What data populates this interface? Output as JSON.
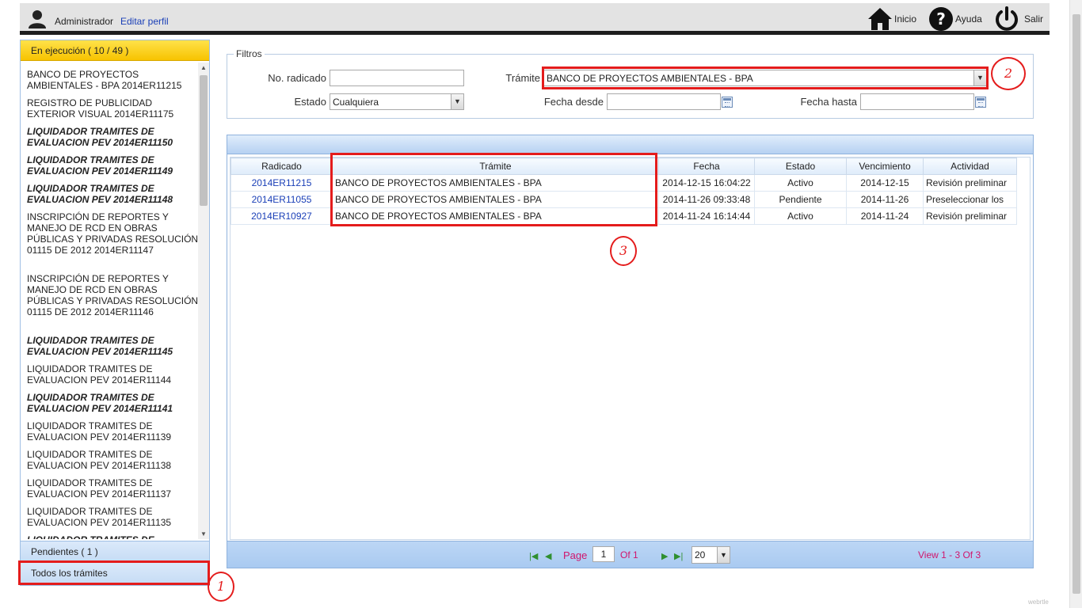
{
  "header": {
    "user_name": "Administrador",
    "edit_profile": "Editar perfil",
    "inicio": "Inicio",
    "ayuda": "Ayuda",
    "salir": "Salir"
  },
  "sidebar": {
    "ejecucion_label": "En ejecución ( 10 / 49 )",
    "pendientes_label": "Pendientes ( 1 )",
    "todos_label": "Todos los trámites",
    "items": [
      {
        "text": "BANCO DE PROYECTOS AMBIENTALES - BPA 2014ER11215",
        "bold": false
      },
      {
        "text": "REGISTRO DE PUBLICIDAD EXTERIOR VISUAL 2014ER11175",
        "bold": false
      },
      {
        "text": "LIQUIDADOR TRAMITES DE EVALUACION PEV 2014ER11150",
        "bold": true
      },
      {
        "text": "LIQUIDADOR TRAMITES DE EVALUACION PEV 2014ER11149",
        "bold": true
      },
      {
        "text": "LIQUIDADOR TRAMITES DE EVALUACION PEV 2014ER11148",
        "bold": true
      },
      {
        "text": "INSCRIPCIÓN DE REPORTES Y MANEJO DE RCD EN OBRAS PÚBLICAS Y PRIVADAS RESOLUCIÓN 01115 DE 2012 2014ER11147",
        "bold": false
      },
      {
        "text": "INSCRIPCIÓN DE REPORTES Y MANEJO DE RCD EN OBRAS PÚBLICAS Y PRIVADAS RESOLUCIÓN 01115 DE 2012 2014ER11146",
        "bold": false
      },
      {
        "text": "LIQUIDADOR TRAMITES DE EVALUACION PEV 2014ER11145",
        "bold": true
      },
      {
        "text": "LIQUIDADOR TRAMITES DE EVALUACION PEV 2014ER11144",
        "bold": false
      },
      {
        "text": "LIQUIDADOR TRAMITES DE EVALUACION PEV 2014ER11141",
        "bold": true
      },
      {
        "text": "LIQUIDADOR TRAMITES DE EVALUACION PEV 2014ER11139",
        "bold": false
      },
      {
        "text": "LIQUIDADOR TRAMITES DE EVALUACION PEV 2014ER11138",
        "bold": false
      },
      {
        "text": "LIQUIDADOR TRAMITES DE EVALUACION PEV 2014ER11137",
        "bold": false
      },
      {
        "text": "LIQUIDADOR TRAMITES DE EVALUACION PEV 2014ER11135",
        "bold": false
      },
      {
        "text": "LIQUIDADOR TRAMITES DE",
        "bold": true
      }
    ]
  },
  "filters": {
    "legend": "Filtros",
    "radicado_label": "No. radicado",
    "radicado_value": "",
    "tramite_label": "Trámite",
    "tramite_value": "BANCO DE PROYECTOS AMBIENTALES - BPA",
    "estado_label": "Estado",
    "estado_value": "Cualquiera",
    "fecha_desde_label": "Fecha desde",
    "fecha_desde_value": "",
    "fecha_hasta_label": "Fecha hasta",
    "fecha_hasta_value": ""
  },
  "grid": {
    "columns": [
      "Radicado",
      "Trámite",
      "Fecha",
      "Estado",
      "Vencimiento",
      "Actividad"
    ],
    "rows": [
      [
        "2014ER11215",
        "BANCO DE PROYECTOS AMBIENTALES - BPA",
        "2014-12-15 16:04:22",
        "Activo",
        "2014-12-15",
        "Revisión preliminar"
      ],
      [
        "2014ER11055",
        "BANCO DE PROYECTOS AMBIENTALES - BPA",
        "2014-11-26 09:33:48",
        "Pendiente",
        "2014-11-26",
        "Preseleccionar los"
      ],
      [
        "2014ER10927",
        "BANCO DE PROYECTOS AMBIENTALES - BPA",
        "2014-11-24 16:14:44",
        "Activo",
        "2014-11-24",
        "Revisión preliminar"
      ]
    ]
  },
  "pager": {
    "page_label": "Page",
    "page_value": "1",
    "of_label": "Of 1",
    "page_size": "20",
    "view_text": "View 1 - 3 Of 3"
  },
  "annotations": {
    "n1": "1",
    "n2": "2",
    "n3": "3"
  },
  "watermark": "webrtle",
  "colors": {
    "accent_yellow": "#f7c300",
    "annotation_red": "#e41c1c",
    "link_blue": "#1a3fb7",
    "pager_text": "#d0156d"
  }
}
